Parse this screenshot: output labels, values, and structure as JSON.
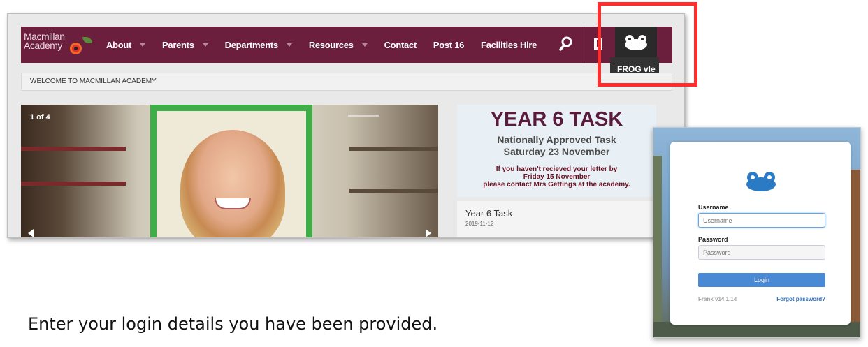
{
  "site": {
    "logo": {
      "line1": "Macmillan",
      "line2": "Academy"
    },
    "nav": [
      {
        "label": "About",
        "has_dropdown": true
      },
      {
        "label": "Parents",
        "has_dropdown": true
      },
      {
        "label": "Departments",
        "has_dropdown": true
      },
      {
        "label": "Resources",
        "has_dropdown": true
      },
      {
        "label": "Contact",
        "has_dropdown": false
      },
      {
        "label": "Post 16",
        "has_dropdown": false
      },
      {
        "label": "Facilities Hire",
        "has_dropdown": false
      }
    ],
    "nav_icons": [
      "search-icon",
      "book-icon",
      "frog-icon"
    ],
    "tooltip": "FROG vle",
    "welcome": "WELCOME TO MACMILLAN ACADEMY",
    "slider": {
      "counter": "1 of 4"
    },
    "task": {
      "title": "YEAR 6 TASK",
      "subtitle1": "Nationally Approved Task",
      "subtitle2": "Saturday 23 November",
      "note_line1": "If you haven't recieved your letter by",
      "note_line2": "Friday 15 November",
      "note_line3": "please contact Mrs Gettings at the academy."
    },
    "list_item": {
      "title": "Year 6 Task",
      "date": "2019-11-12"
    },
    "colors": {
      "nav_bg": "#6b1f3d",
      "highlight": "#ff2e2e",
      "task_title": "#5a1a3a"
    }
  },
  "login": {
    "username_label": "Username",
    "username_placeholder": "Username",
    "password_label": "Password",
    "password_placeholder": "Password",
    "button": "Login",
    "version": "Frank v14.1.14",
    "forgot": "Forgot password?",
    "colors": {
      "button": "#4a8ad4",
      "frog": "#2a7bc4"
    }
  },
  "caption": "Enter your login details you have been provided."
}
